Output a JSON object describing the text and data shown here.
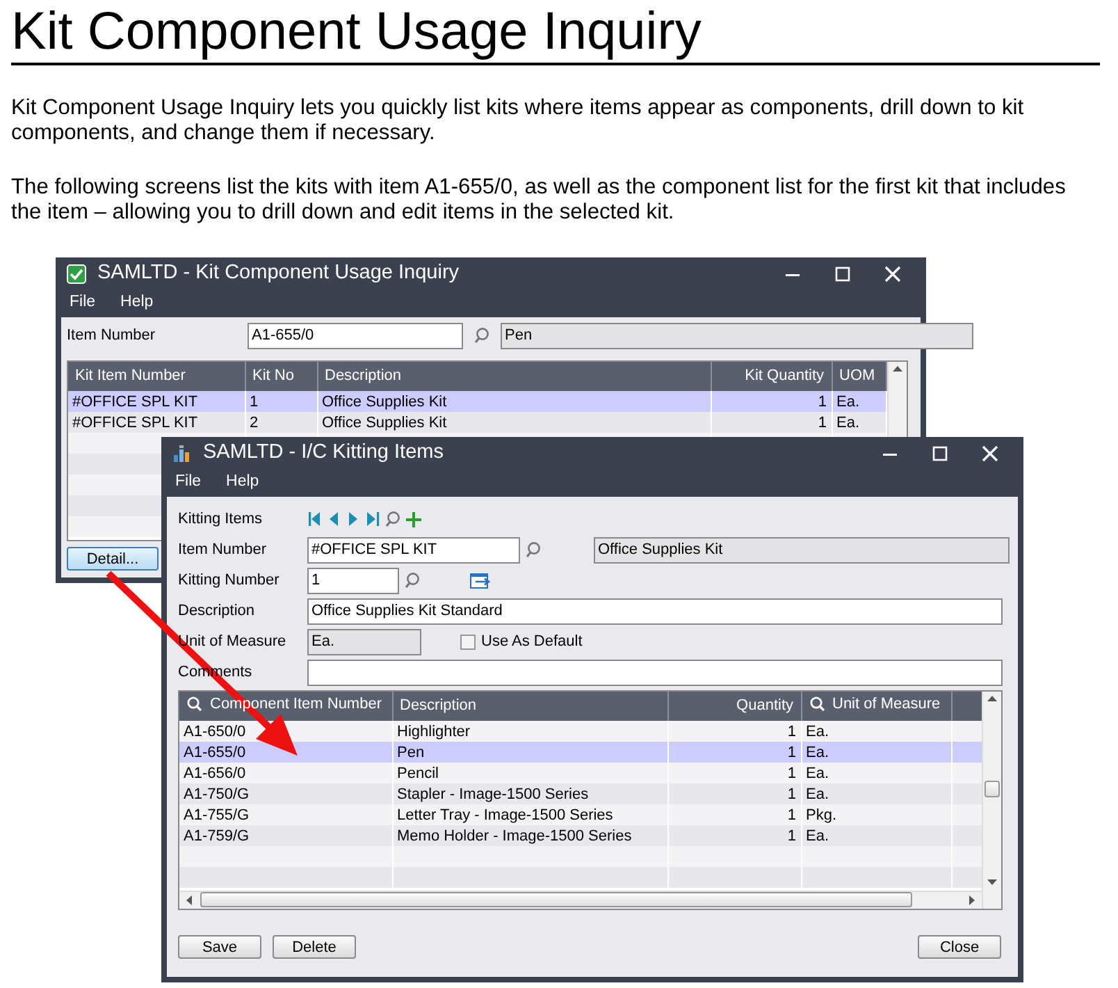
{
  "heading": "Kit Component Usage Inquiry",
  "paragraphs": [
    "Kit Component Usage Inquiry lets you quickly list kits where items appear as components, drill down to kit components, and change them if necessary.",
    "The following screens list the kits with item A1-655/0, as well as the component list for the first kit that includes the item – allowing you to drill down and edit items in the selected kit."
  ],
  "inquiry_window": {
    "title": "SAMLTD - Kit Component Usage Inquiry",
    "menu": [
      "File",
      "Help"
    ],
    "item_number": {
      "label": "Item Number",
      "value": "A1-655/0",
      "description": "Pen"
    },
    "grid": {
      "columns": [
        {
          "label": "Kit Item Number"
        },
        {
          "label": "Kit No"
        },
        {
          "label": "Description"
        },
        {
          "label": "Kit Quantity"
        },
        {
          "label": "UOM"
        }
      ],
      "rows": [
        {
          "cells": [
            "#OFFICE SPL KIT",
            "1",
            "Office Supplies Kit",
            "1",
            "Ea."
          ],
          "selected": true
        },
        {
          "cells": [
            "#OFFICE SPL KIT",
            "2",
            "Office Supplies Kit",
            "1",
            "Ea."
          ],
          "selected": false
        }
      ]
    },
    "buttons": [
      "Detail..."
    ]
  },
  "kitting_window": {
    "title": "SAMLTD - I/C Kitting Items",
    "menu": [
      "File",
      "Help"
    ],
    "kitting_items": {
      "label": "Kitting Items"
    },
    "item_number": {
      "label": "Item Number",
      "value": "#OFFICE SPL KIT",
      "description": "Office Supplies Kit"
    },
    "kitting_number": {
      "label": "Kitting Number",
      "value": "1"
    },
    "description": {
      "label": "Description",
      "value": "Office Supplies Kit Standard"
    },
    "unit_of_measure": {
      "label": "Unit of Measure",
      "value": "Ea."
    },
    "use_as_default": {
      "label": "Use As Default",
      "checked": false
    },
    "comments": {
      "label": "Comments"
    },
    "grid": {
      "columns": [
        {
          "label": "Component Item Number",
          "searchable": true
        },
        {
          "label": "Description",
          "searchable": false
        },
        {
          "label": "Quantity",
          "searchable": false
        },
        {
          "label": "Unit of Measure",
          "searchable": true
        }
      ],
      "rows": [
        {
          "cells": [
            "A1-650/0",
            "Highlighter",
            "1",
            "Ea."
          ],
          "selected": false
        },
        {
          "cells": [
            "A1-655/0",
            "Pen",
            "1",
            "Ea."
          ],
          "selected": true
        },
        {
          "cells": [
            "A1-656/0",
            "Pencil",
            "1",
            "Ea."
          ],
          "selected": false
        },
        {
          "cells": [
            "A1-750/G",
            "Stapler - Image-1500 Series",
            "1",
            "Ea."
          ],
          "selected": false
        },
        {
          "cells": [
            "A1-755/G",
            "Letter Tray - Image-1500 Series",
            "1",
            "Pkg."
          ],
          "selected": false
        },
        {
          "cells": [
            "A1-759/G",
            "Memo Holder - Image-1500 Series",
            "1",
            "Ea."
          ],
          "selected": false
        }
      ]
    },
    "buttons": {
      "left": [
        "Save",
        "Delete"
      ],
      "right": [
        "Close"
      ]
    }
  }
}
